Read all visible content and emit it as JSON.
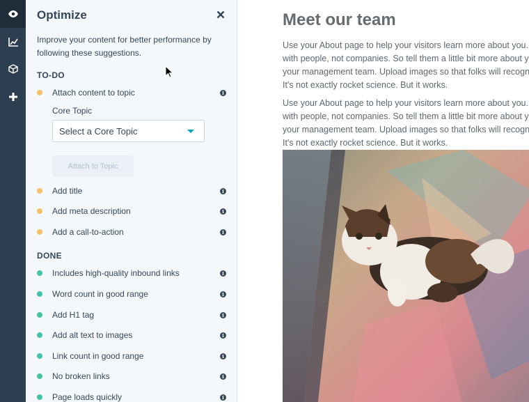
{
  "rail": {
    "items": [
      "eye-icon",
      "chart-icon",
      "cube-icon",
      "plus-icon"
    ],
    "active_index": 0
  },
  "panel": {
    "title": "Optimize",
    "intro": "Improve your content for better performance by following these suggestions.",
    "todo_heading": "TO-DO",
    "todo_items": [
      {
        "label": "Attach content to topic"
      },
      {
        "label": "Add title"
      },
      {
        "label": "Add meta description"
      },
      {
        "label": "Add a call-to-action"
      }
    ],
    "core_topic_label": "Core Topic",
    "core_topic_select": "Select a Core Topic",
    "attach_button": "Attach to Topic",
    "done_heading": "DONE",
    "done_items": [
      {
        "label": "Includes high-quality inbound links"
      },
      {
        "label": "Word count in good range"
      },
      {
        "label": "Add H1 tag"
      },
      {
        "label": "Add alt text to images"
      },
      {
        "label": "Link count in good range"
      },
      {
        "label": "No broken links"
      },
      {
        "label": "Page loads quickly"
      }
    ],
    "colors": {
      "todo": "#f5c26b",
      "done": "#45c3a6"
    }
  },
  "main": {
    "title": "Meet our team",
    "paragraphs": [
      [
        "Use your About page to help your visitors learn more about you. People want to do business",
        "with people, not companies. So tell them a little bit more about you, your organization, and",
        "your management team. Upload images so that folks will recognize you when you meet.",
        "It's not exactly rocket science. But it works."
      ],
      [
        "Use your About page to help your visitors learn more about you. People want to do business",
        "with people, not companies. So tell them a little bit more about you, your organization, and",
        "your management team. Upload images so that folks will recognize you when you meet.",
        "It's not exactly rocket science. But it works."
      ]
    ]
  }
}
